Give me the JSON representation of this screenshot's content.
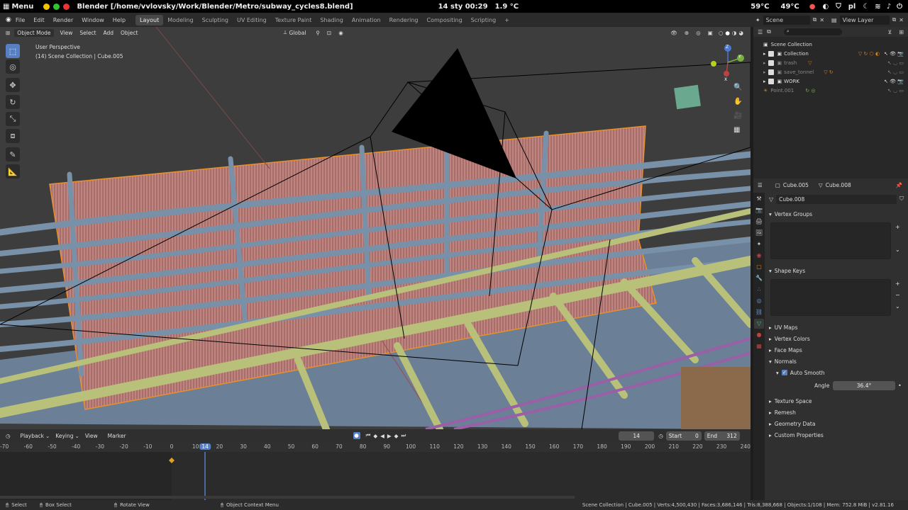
{
  "os_bar": {
    "menu": "Menu",
    "window_title": "Blender [/home/vvlovsky/Work/Blender/Metro/subway_cycles8.blend]",
    "datetime": "14 sty  00:29",
    "weather": "1.9 °C",
    "cpu_temp": "59°C",
    "battery": "49°C",
    "lang": "pl"
  },
  "menubar": {
    "items": [
      "File",
      "Edit",
      "Render",
      "Window",
      "Help"
    ],
    "workspaces": [
      "Layout",
      "Modeling",
      "Sculpting",
      "UV Editing",
      "Texture Paint",
      "Shading",
      "Animation",
      "Rendering",
      "Compositing",
      "Scripting"
    ],
    "active_workspace": "Layout",
    "scene": "Scene",
    "view_layer": "View Layer"
  },
  "viewport": {
    "mode": "Object Mode",
    "menus": [
      "View",
      "Select",
      "Add",
      "Object"
    ],
    "orientation": "Global",
    "info_line1": "User Perspective",
    "info_line2": "(14) Scene Collection | Cube.005",
    "gizmo_x": "X",
    "gizmo_y": "Y",
    "gizmo_z": "Z"
  },
  "outliner": {
    "root": "Scene Collection",
    "rows": [
      {
        "label": "Collection",
        "enabled": true
      },
      {
        "label": "trash",
        "enabled": true
      },
      {
        "label": "save_tonnel",
        "enabled": true
      },
      {
        "label": "WORK",
        "enabled": true
      },
      {
        "label": "Point.001",
        "enabled": false
      }
    ]
  },
  "properties": {
    "object": "Cube.005",
    "data": "Cube.008",
    "mesh_name": "Cube.008",
    "vertex_groups": "Vertex Groups",
    "shape_keys": "Shape Keys",
    "uv_maps": "UV Maps",
    "vertex_colors": "Vertex Colors",
    "face_maps": "Face Maps",
    "normals": "Normals",
    "auto_smooth": "Auto Smooth",
    "angle_label": "Angle",
    "angle_value": "36.4°",
    "texture_space": "Texture Space",
    "remesh": "Remesh",
    "geometry_data": "Geometry Data",
    "custom_properties": "Custom Properties"
  },
  "timeline": {
    "menus": [
      "Playback",
      "Keying",
      "View",
      "Marker"
    ],
    "current_frame": "14",
    "start_label": "Start",
    "start": "0",
    "end_label": "End",
    "end": "312",
    "ruler": [
      "-70",
      "-60",
      "-50",
      "-40",
      "-30",
      "-20",
      "-10",
      "0",
      "10",
      "14",
      "20",
      "30",
      "40",
      "50",
      "60",
      "70",
      "80",
      "90",
      "100",
      "110",
      "120",
      "130",
      "140",
      "150",
      "160",
      "170",
      "180",
      "190",
      "200",
      "210",
      "220",
      "230",
      "240"
    ]
  },
  "status": {
    "select": "Select",
    "box_select": "Box Select",
    "rotate_view": "Rotate View",
    "context_menu": "Object Context Menu",
    "stats": "Scene Collection | Cube.005 | Verts:4,500,430 | Faces:3,686,146 | Tris:8,388,668 | Objects:1/108 | Mem: 752.8 MiB | v2.81.16"
  },
  "colors": {
    "accent": "#5680c2",
    "selection": "#f0a030",
    "pipe": "#7890a8",
    "rail": "#b8c07a"
  }
}
